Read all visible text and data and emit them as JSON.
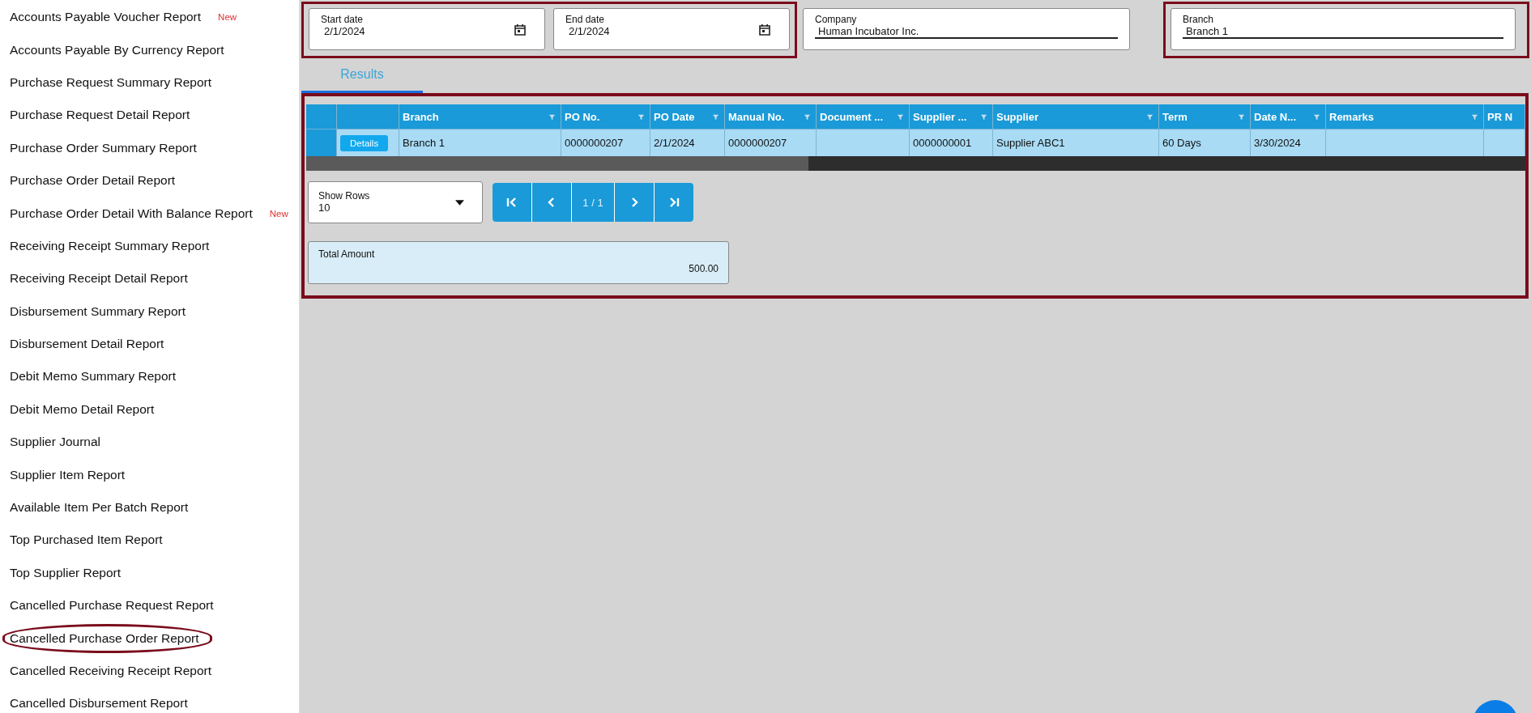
{
  "sidebar": {
    "items": [
      {
        "label": "Accounts Payable Voucher Report",
        "badge": "New",
        "highlighted": false
      },
      {
        "label": "Accounts Payable By Currency Report",
        "highlighted": false
      },
      {
        "label": "Purchase Request Summary Report",
        "highlighted": false
      },
      {
        "label": "Purchase Request Detail Report",
        "highlighted": false
      },
      {
        "label": "Purchase Order Summary Report",
        "highlighted": false
      },
      {
        "label": "Purchase Order Detail Report",
        "highlighted": false
      },
      {
        "label": "Purchase Order Detail With Balance Report",
        "badge": "New",
        "highlighted": false
      },
      {
        "label": "Receiving Receipt Summary Report",
        "highlighted": false
      },
      {
        "label": "Receiving Receipt Detail Report",
        "highlighted": false
      },
      {
        "label": "Disbursement Summary Report",
        "highlighted": false
      },
      {
        "label": "Disbursement Detail Report",
        "highlighted": false
      },
      {
        "label": "Debit Memo Summary Report",
        "highlighted": false
      },
      {
        "label": "Debit Memo Detail Report",
        "highlighted": false
      },
      {
        "label": "Supplier Journal",
        "highlighted": false
      },
      {
        "label": "Supplier Item Report",
        "highlighted": false
      },
      {
        "label": "Available Item Per Batch Report",
        "highlighted": false
      },
      {
        "label": "Top Purchased Item Report",
        "highlighted": false
      },
      {
        "label": "Top Supplier Report",
        "highlighted": false
      },
      {
        "label": "Cancelled Purchase Request Report",
        "highlighted": false
      },
      {
        "label": "Cancelled Purchase Order Report",
        "highlighted": true
      },
      {
        "label": "Cancelled Receiving Receipt Report",
        "highlighted": false
      },
      {
        "label": "Cancelled Disbursement Report",
        "highlighted": false
      }
    ]
  },
  "filter_groups": [
    {
      "highlighted": true,
      "fields": [
        {
          "kind": "date",
          "label": "Start date",
          "value": "2/1/2024"
        },
        {
          "kind": "date",
          "label": "End date",
          "value": "2/1/2024"
        }
      ]
    },
    {
      "highlighted": false,
      "fields": [
        {
          "kind": "text",
          "label": "Company",
          "value": "Human Incubator Inc."
        }
      ]
    },
    {
      "highlighted": true,
      "fields": [
        {
          "kind": "text",
          "label": "Branch",
          "value": "Branch 1"
        }
      ]
    }
  ],
  "tabs": [
    {
      "label": "Results",
      "selected": true
    }
  ],
  "results": {
    "highlighted": true,
    "table": {
      "columns": [
        {
          "label": "Branch"
        },
        {
          "label": "PO No."
        },
        {
          "label": "PO Date"
        },
        {
          "label": "Manual No."
        },
        {
          "label": "Document ..."
        },
        {
          "label": "Supplier ..."
        },
        {
          "label": "Supplier"
        },
        {
          "label": "Term"
        },
        {
          "label": "Date N..."
        },
        {
          "label": "Remarks"
        },
        {
          "label": "PR N"
        }
      ],
      "rows": [
        {
          "action": "Details",
          "cells": [
            "Branch 1",
            "0000000207",
            "2/1/2024",
            "0000000207",
            "",
            "0000000001",
            "Supplier ABC1",
            "60 Days",
            "3/30/2024",
            "",
            ""
          ]
        }
      ]
    },
    "show_rows": {
      "label": "Show Rows",
      "value": "10"
    },
    "pager": {
      "page": "1 / 1"
    },
    "total": {
      "label": "Total Amount",
      "value": "500.00"
    }
  }
}
